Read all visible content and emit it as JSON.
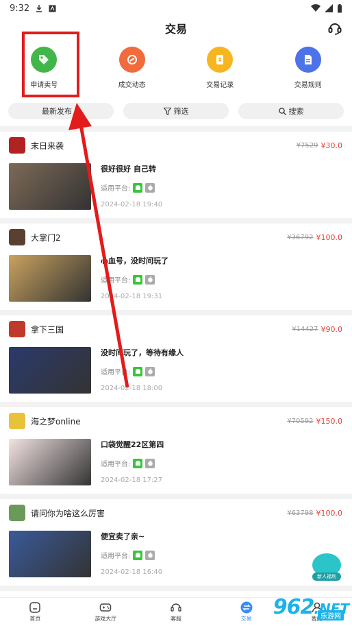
{
  "status_bar": {
    "time": "9:32"
  },
  "header": {
    "title": "交易"
  },
  "quick_actions": [
    {
      "label": "申请卖号",
      "color": "#43b649",
      "icon": "tag-icon"
    },
    {
      "label": "成交动态",
      "color": "#f26b3c",
      "icon": "deal-icon"
    },
    {
      "label": "交易记录",
      "color": "#f7b51f",
      "icon": "record-icon"
    },
    {
      "label": "交易规则",
      "color": "#4d73e8",
      "icon": "rules-icon"
    }
  ],
  "filters": {
    "latest": "最新发布",
    "filter": "筛选",
    "search": "搜索"
  },
  "platform_label": "适用平台:",
  "listings": [
    {
      "game": "末日来袭",
      "old_price": "¥7529",
      "price": "¥30.0",
      "desc": "很好很好 自己转",
      "time": "2024-02-18 19:40",
      "icon_color": "#b22222",
      "thumb_color": "#7d6a57"
    },
    {
      "game": "大掌门2",
      "old_price": "¥36792",
      "price": "¥100.0",
      "desc": "心血号，没时间玩了",
      "time": "2024-02-18 19:31",
      "icon_color": "#5a4030",
      "thumb_color": "#c9a25e"
    },
    {
      "game": "拿下三国",
      "old_price": "¥14427",
      "price": "¥90.0",
      "desc": "没时间玩了，等待有缘人",
      "time": "2024-02-18 18:00",
      "icon_color": "#c0392b",
      "thumb_color": "#2b3a6b"
    },
    {
      "game": "海之梦online",
      "old_price": "¥70592",
      "price": "¥150.0",
      "desc": "口袋觉醒22区第四",
      "time": "2024-02-18 17:27",
      "icon_color": "#e8c23a",
      "thumb_color": "#f3e3e3"
    },
    {
      "game": "请问你为啥这么厉害",
      "old_price": "¥63798",
      "price": "¥100.0",
      "desc": "便宜卖了亲~",
      "time": "2024-02-18 16:40",
      "icon_color": "#6a9a5a",
      "thumb_color": "#3a5a9a"
    }
  ],
  "float_badge": {
    "label": "新人福利"
  },
  "watermark": {
    "num": "962",
    "net": ".NET",
    "sub": "乐游网"
  },
  "tabbar": [
    {
      "label": "首页",
      "icon": "home-icon"
    },
    {
      "label": "游戏大厅",
      "icon": "gamepad-icon"
    },
    {
      "label": "客服",
      "icon": "headset-icon"
    },
    {
      "label": "交易",
      "icon": "exchange-icon"
    },
    {
      "label": "我的",
      "icon": "user-icon"
    }
  ]
}
